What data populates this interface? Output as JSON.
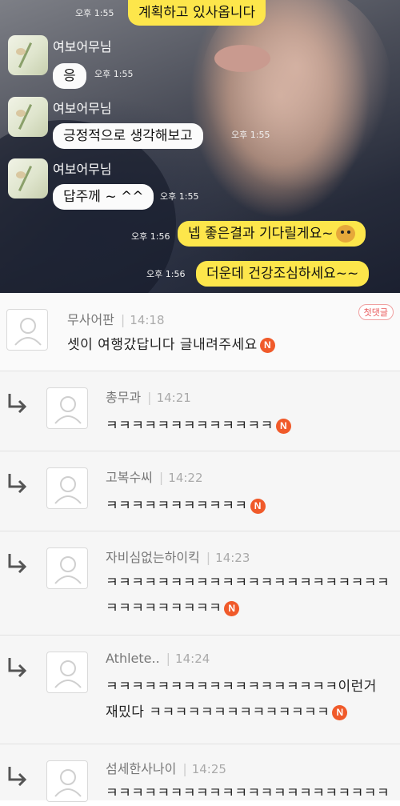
{
  "chat": {
    "messages": [
      {
        "sender": "",
        "text": "계획하고 있사옵니다",
        "time": "오후 1:55",
        "side": "right-top"
      },
      {
        "sender": "여보어무님",
        "text": "응",
        "time": "오후 1:55"
      },
      {
        "sender": "여보어무님",
        "text": "긍정적으로 생각해보고",
        "time": "오후 1:55"
      },
      {
        "sender": "여보어무님",
        "text": "답주께 ~ ^^",
        "time": "오후 1:55"
      },
      {
        "sender": "",
        "text": "넵 좋은결과 기다릴게요~",
        "time": "오후 1:56"
      },
      {
        "sender": "",
        "text": "더운데 건강조심하세요~~",
        "time": "오후 1:56"
      }
    ]
  },
  "comments": [
    {
      "name": "무사어판",
      "time": "14:18",
      "lines": [
        "셋이 여행갔답니다 글내려주세요"
      ],
      "badge": "N",
      "label": "첫댓글"
    },
    {
      "name": "총무과",
      "time": "14:21",
      "lines": [
        "ㅋㅋㅋㅋㅋㅋㅋㅋㅋㅋㅋㅋㅋ"
      ],
      "badge": "N"
    },
    {
      "name": "고복수씨",
      "time": "14:22",
      "lines": [
        "ㅋㅋㅋㅋㅋㅋㅋㅋㅋㅋㅋ"
      ],
      "badge": "N"
    },
    {
      "name": "자비심없는하이킥",
      "time": "14:23",
      "lines": [
        "ㅋㅋㅋㅋㅋㅋㅋㅋㅋㅋㅋㅋㅋㅋㅋㅋㅋㅋㅋㅋㅋㅋ",
        "ㅋㅋㅋㅋㅋㅋㅋㅋㅋ"
      ],
      "badge": "N"
    },
    {
      "name": "Athlete..",
      "time": "14:24",
      "lines": [
        "ㅋㅋㅋㅋㅋㅋㅋㅋㅋㅋㅋㅋㅋㅋㅋㅋㅋㅋ이런거",
        "재밌다 ㅋㅋㅋㅋㅋㅋㅋㅋㅋㅋㅋㅋㅋㅋ"
      ],
      "badge": "N"
    },
    {
      "name": "섬세한사나이",
      "time": "14:25",
      "lines": [
        "ㅋㅋㅋㅋㅋㅋㅋㅋㅋㅋㅋㅋㅋㅋㅋㅋㅋㅋㅋㅋㅋㅋ"
      ],
      "badge": ""
    }
  ],
  "colors": {
    "yellow_bubble": "#fde64b",
    "new_badge": "#f05a2a",
    "first_label": "#e8585a"
  }
}
